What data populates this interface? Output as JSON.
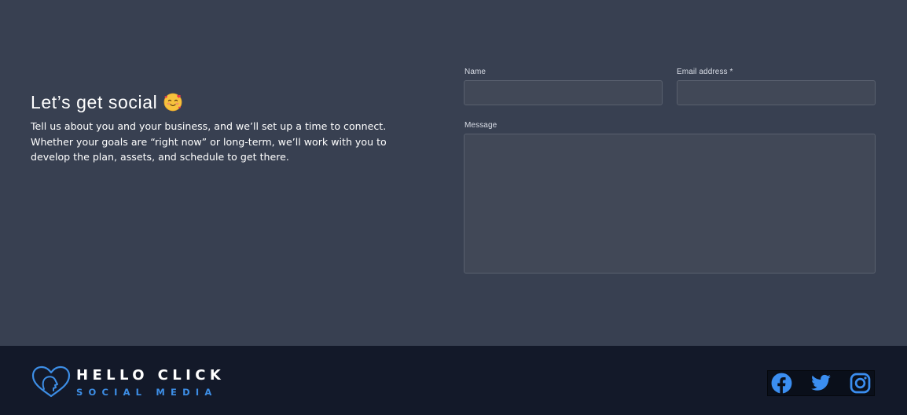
{
  "intro": {
    "heading": "Let’s get social",
    "emoji_icon": "smiling-face-with-hearts-icon",
    "body": "Tell us about you and your business, and we’ll set up a time to connect. Whether your goals are “right now” or long-term, we’ll work with you to develop the plan, assets, and schedule to get there."
  },
  "form": {
    "name_label": "Name",
    "name_value": "",
    "email_label": "Email address *",
    "email_value": "",
    "message_label": "Message",
    "message_value": ""
  },
  "footer": {
    "logo_line1": "HELLO CLICK",
    "logo_line2": "SOCIAL MEDIA",
    "logo_icon": "heart-head-icon",
    "socials": [
      {
        "name": "Facebook",
        "icon": "facebook-icon"
      },
      {
        "name": "Twitter",
        "icon": "twitter-icon"
      },
      {
        "name": "Instagram",
        "icon": "instagram-icon"
      }
    ]
  },
  "colors": {
    "background": "#384051",
    "footer": "#131929",
    "input_bg": "#414857",
    "input_border": "#59606e",
    "accent": "#3d8ee6",
    "social_icon": "#3b8ef0"
  }
}
